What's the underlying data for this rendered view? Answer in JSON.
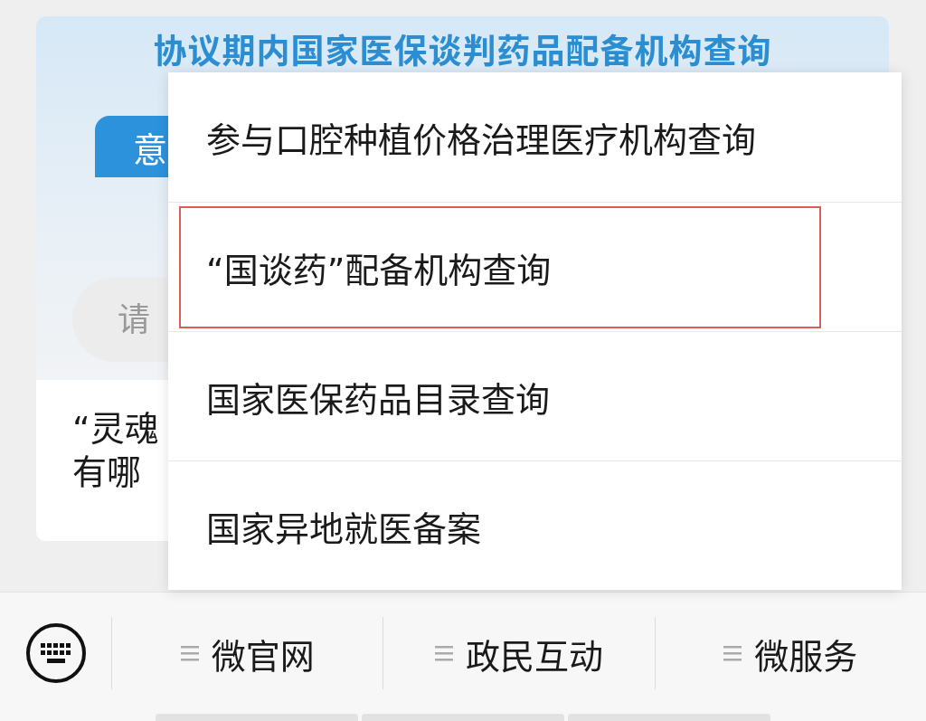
{
  "banner": {
    "title": "协议期内国家医保谈判药品配备机构查询",
    "tab": {
      "label": "意"
    },
    "search": {
      "placeholder": "请"
    }
  },
  "article": {
    "lines": [
      "“灵魂",
      "有哪"
    ]
  },
  "popup_menu": {
    "items": [
      {
        "label": "参与口腔种植价格治理医疗机构查询",
        "selected": false
      },
      {
        "label": "“国谈药”配备机构查询",
        "selected": true
      },
      {
        "label": "国家医保药品目录查询",
        "selected": false
      },
      {
        "label": "国家异地就医备案",
        "selected": false
      }
    ]
  },
  "bottom_bar": {
    "items": [
      {
        "label": "微官网"
      },
      {
        "label": "政民互动"
      },
      {
        "label": "微服务"
      }
    ]
  }
}
